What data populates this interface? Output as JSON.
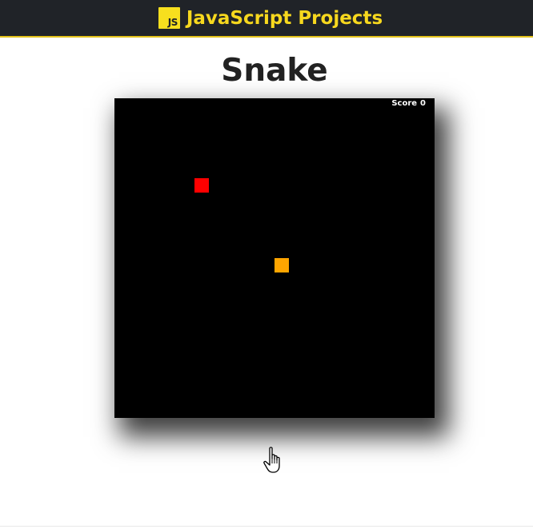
{
  "header": {
    "logo_text": "JS",
    "title": "JavaScript Projects",
    "logo_color": "#f7df1e",
    "bar_color": "#202328",
    "accent_color": "#f7d81e"
  },
  "page": {
    "title": "Snake"
  },
  "game": {
    "score_label": "Score",
    "score_value": "0",
    "board_color": "#000000",
    "food_color": "#ff0000",
    "snake_color": "#ffa500"
  },
  "cursor": {
    "icon": "hand-pointer-icon"
  }
}
